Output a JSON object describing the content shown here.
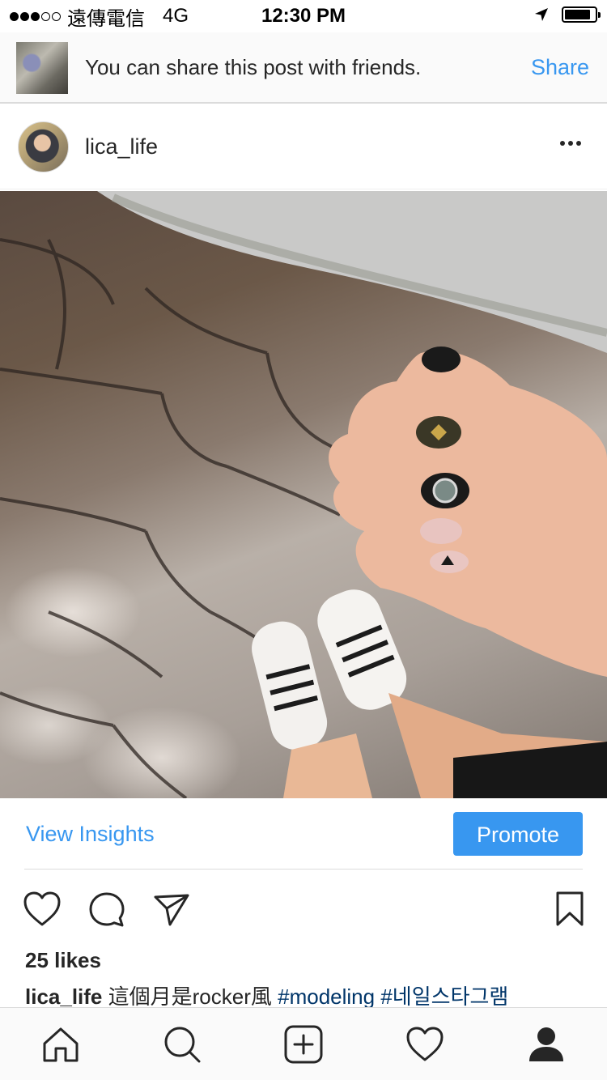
{
  "status_bar": {
    "carrier": "遠傳電信",
    "network": "4G",
    "time": "12:30 PM",
    "signal_bars": 3,
    "signal_total": 5,
    "battery_level": 0.85,
    "icons": [
      "location-arrow-icon",
      "battery-icon"
    ]
  },
  "share_banner": {
    "message": "You can share this post with friends.",
    "action_label": "Share"
  },
  "post": {
    "username": "lica_life",
    "more_icon": "more-horizontal-icon",
    "image_icon": "post-photo",
    "insights_label": "View Insights",
    "promote_label": "Promote",
    "actions": [
      "heart-icon",
      "comment-icon",
      "send-icon",
      "bookmark-icon"
    ],
    "likes": "25 likes",
    "caption": {
      "user": "lica_life",
      "text": "這個月是rocker風",
      "hashtags": [
        "#modeling",
        "#네일스타그램"
      ]
    }
  },
  "tab_bar": {
    "items": [
      "home-icon",
      "search-icon",
      "new-post-icon",
      "activity-heart-icon",
      "profile-icon"
    ]
  },
  "colors": {
    "accent": "#3897f0",
    "text": "#262626",
    "hashtag": "#003569",
    "divider": "#dbdbdb",
    "banner_bg": "#fafafa"
  }
}
